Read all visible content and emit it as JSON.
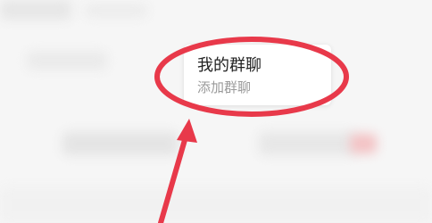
{
  "popup_menu": {
    "items": [
      {
        "label": "我的群聊"
      },
      {
        "label": "添加群聊"
      }
    ]
  },
  "annotation": {
    "color": "#e8394a",
    "shapes": [
      "circle-highlight",
      "arrow-up-icon"
    ]
  }
}
